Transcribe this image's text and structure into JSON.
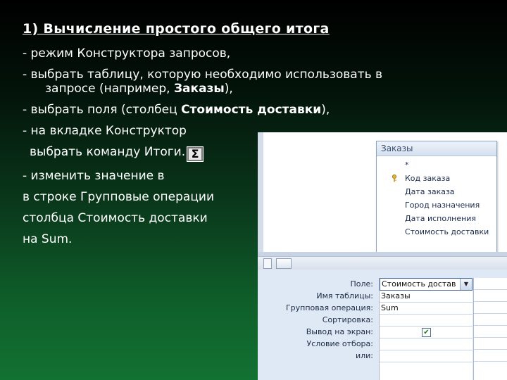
{
  "slide": {
    "title": "1) Вычисление простого общего итога",
    "lines": [
      "- режим Конструктора запросов,",
      "- выбрать  таблицу, которую необходимо использовать в",
      "запросе (например, ",
      "Заказы",
      "),",
      "- выбрать поля (столбец ",
      "Стоимость доставки",
      "),",
      "- на вкладке Конструктор",
      "выбрать команду Итоги.",
      "- изменить значение в",
      "в строке Групповые операции",
      "столбца  Стоимость доставки",
      "на Sum."
    ],
    "sigma_symbol": "Σ"
  },
  "designer": {
    "table_name": "Заказы",
    "fields": [
      "*",
      "Код заказа",
      "Дата заказа",
      "Город назначения",
      "Дата исполнения",
      "Стоимость доставки"
    ],
    "row_labels": [
      "Поле:",
      "Имя таблицы:",
      "Групповая операция:",
      "Сортировка:",
      "Вывод на экран:",
      "Условие отбора:",
      "или:"
    ],
    "column": {
      "field": "Стоимость достав",
      "table": "Заказы",
      "group": "Sum",
      "show_checked": true
    },
    "dropdown_arrow": "▼",
    "check_mark": "✔"
  }
}
